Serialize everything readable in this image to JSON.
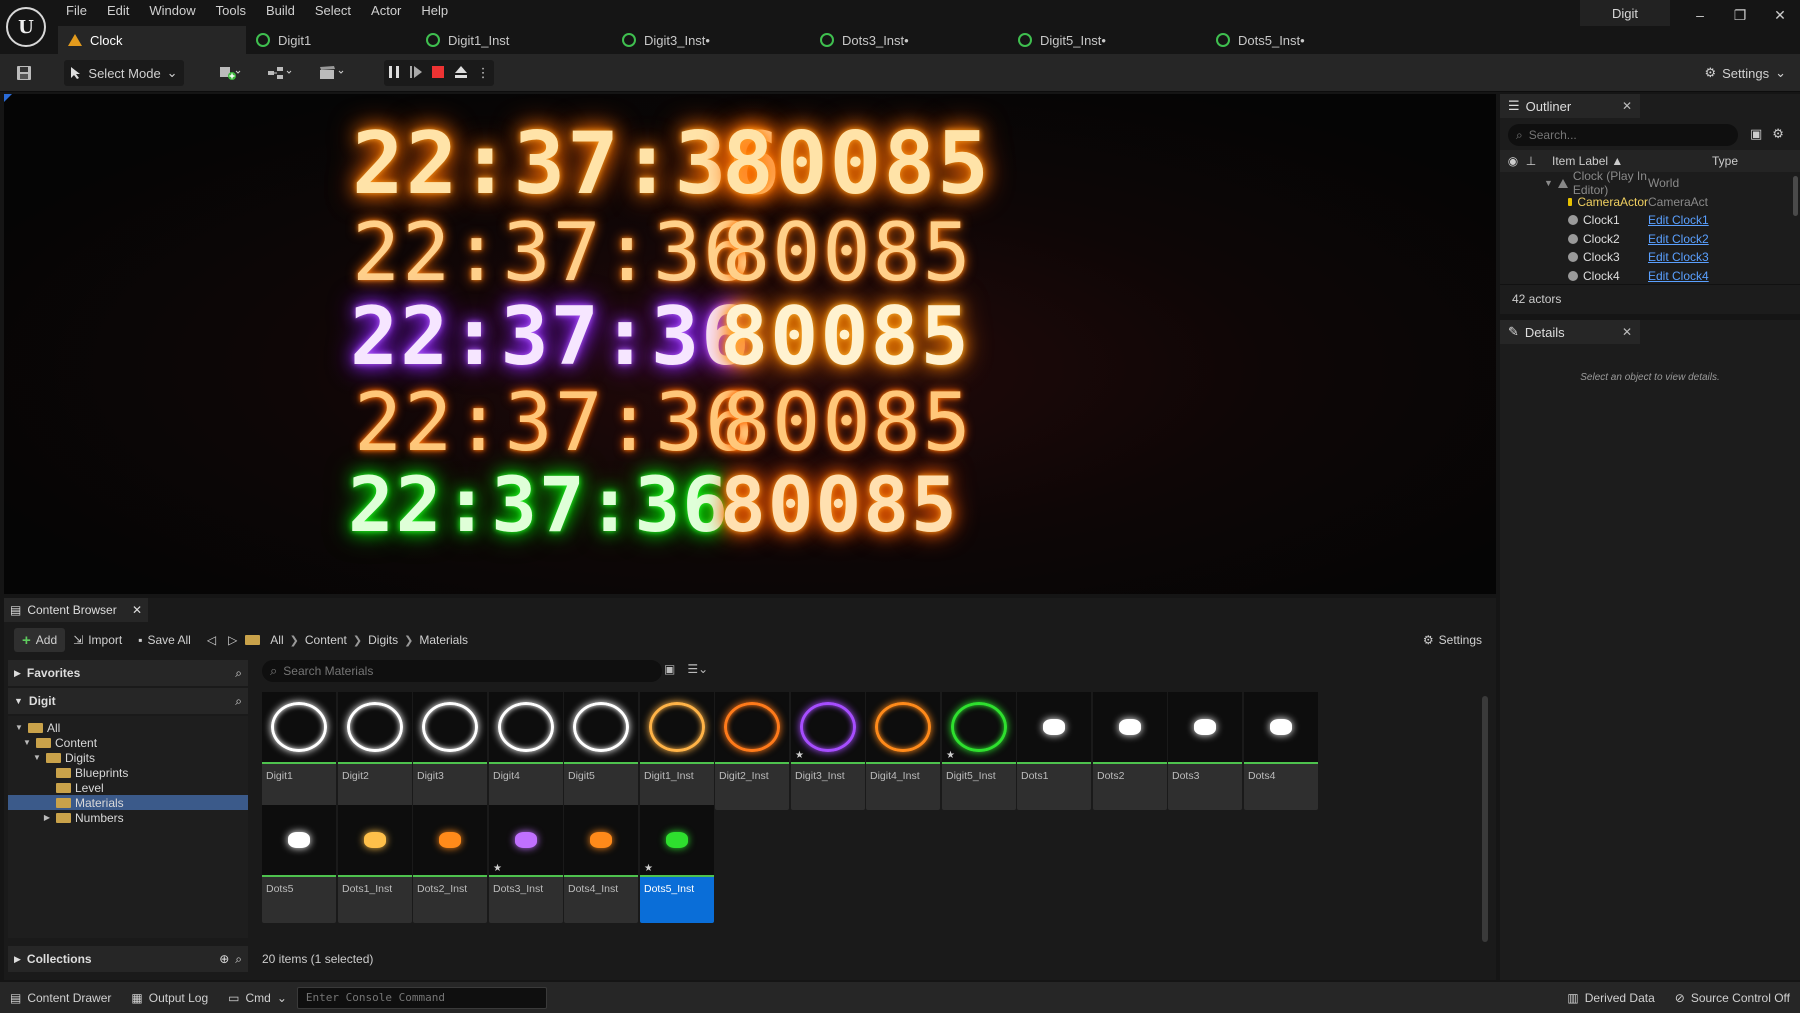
{
  "app": {
    "title": "Digit",
    "logo": "U"
  },
  "menu": [
    "File",
    "Edit",
    "Window",
    "Tools",
    "Build",
    "Select",
    "Actor",
    "Help"
  ],
  "tabs": [
    {
      "label": "Clock",
      "icon": "level-icon"
    },
    {
      "label": "Digit1",
      "icon": "material-icon"
    },
    {
      "label": "Digit1_Inst",
      "icon": "material-icon"
    },
    {
      "label": "Digit3_Inst•",
      "icon": "material-icon"
    },
    {
      "label": "Dots3_Inst•",
      "icon": "material-icon"
    },
    {
      "label": "Digit5_Inst•",
      "icon": "material-icon"
    },
    {
      "label": "Dots5_Inst•",
      "icon": "material-icon"
    }
  ],
  "window_controls": {
    "minimize": "–",
    "restore": "❐",
    "close": "✕"
  },
  "toolbar": {
    "select_mode": "Select Mode",
    "settings": "Settings"
  },
  "viewport": {
    "clocks": [
      "22:37:36",
      "22:37:36",
      "22:37:36",
      "22:37:36",
      "22:37:36"
    ],
    "numbers": [
      "80085",
      "80085",
      "80085",
      "80085",
      "80085"
    ]
  },
  "outliner": {
    "tab": "Outliner",
    "search_placeholder": "Search...",
    "col_label": "Item Label ▲",
    "col_type": "Type",
    "rows": [
      {
        "label": "Clock (Play In Editor)",
        "type": "World"
      },
      {
        "label": "CameraActor",
        "type": "CameraAct"
      },
      {
        "label": "Clock1",
        "type": "Edit Clock1"
      },
      {
        "label": "Clock2",
        "type": "Edit Clock2"
      },
      {
        "label": "Clock3",
        "type": "Edit Clock3"
      },
      {
        "label": "Clock4",
        "type": "Edit Clock4"
      }
    ],
    "count": "42 actors"
  },
  "details": {
    "tab": "Details",
    "empty": "Select an object to view details."
  },
  "content_browser": {
    "tab": "Content Browser",
    "add": "Add",
    "import": "Import",
    "save_all": "Save All",
    "breadcrumb": [
      "All",
      "Content",
      "Digits",
      "Materials"
    ],
    "settings": "Settings",
    "favorites": "Favorites",
    "project": "Digit",
    "tree": [
      "All",
      "Content",
      "Digits",
      "Blueprints",
      "Level",
      "Materials",
      "Numbers"
    ],
    "collections": "Collections",
    "search_placeholder": "Search Materials",
    "assets": [
      {
        "name": "Digit1",
        "color": "#ffffff"
      },
      {
        "name": "Digit2",
        "color": "#ffffff"
      },
      {
        "name": "Digit3",
        "color": "#ffffff"
      },
      {
        "name": "Digit4",
        "color": "#ffffff"
      },
      {
        "name": "Digit5",
        "color": "#ffffff"
      },
      {
        "name": "Digit1_Inst",
        "color": "#ffb347"
      },
      {
        "name": "Digit2_Inst",
        "color": "#ff7a1a"
      },
      {
        "name": "Digit3_Inst",
        "color": "#a64dff"
      },
      {
        "name": "Digit4_Inst",
        "color": "#ff8a1a"
      },
      {
        "name": "Digit5_Inst",
        "color": "#2ee02e"
      },
      {
        "name": "Dots1",
        "color": "#ffffff"
      },
      {
        "name": "Dots2",
        "color": "#ffffff"
      },
      {
        "name": "Dots3",
        "color": "#ffffff"
      },
      {
        "name": "Dots4",
        "color": "#ffffff"
      },
      {
        "name": "Dots5",
        "color": "#ffffff"
      },
      {
        "name": "Dots1_Inst",
        "color": "#ffc04a"
      },
      {
        "name": "Dots2_Inst",
        "color": "#ff8a1a"
      },
      {
        "name": "Dots3_Inst",
        "color": "#c070ff"
      },
      {
        "name": "Dots4_Inst",
        "color": "#ff8a1a"
      },
      {
        "name": "Dots5_Inst",
        "color": "#2ee02e"
      }
    ],
    "status": "20 items (1 selected)"
  },
  "statusbar": {
    "content_drawer": "Content Drawer",
    "output_log": "Output Log",
    "cmd": "Cmd",
    "console_placeholder": "Enter Console Command",
    "derived_data": "Derived Data",
    "source_control": "Source Control Off"
  }
}
